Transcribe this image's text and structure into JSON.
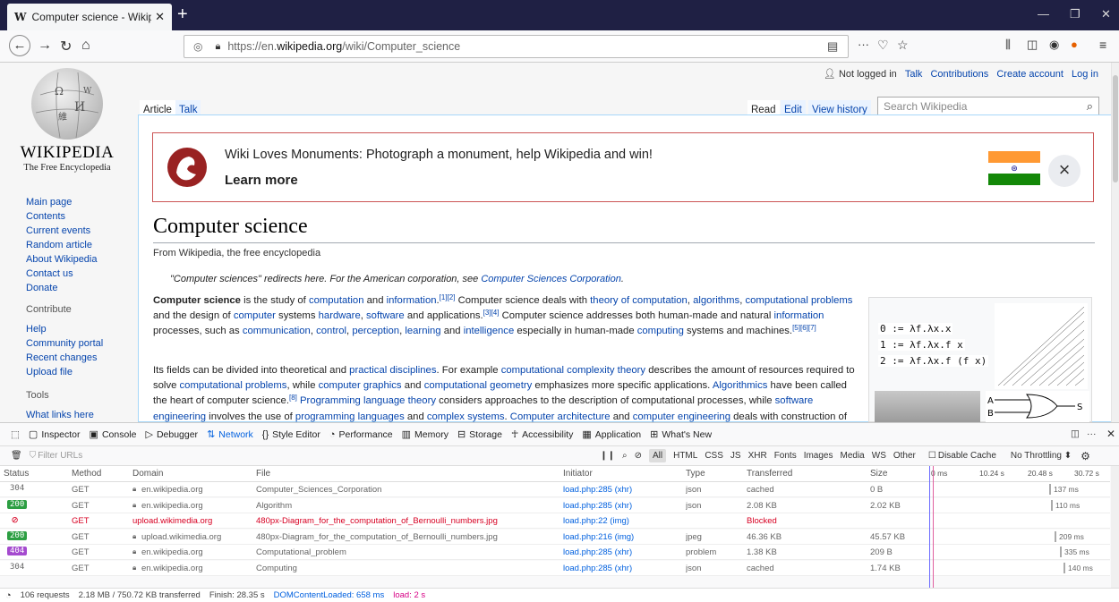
{
  "browser": {
    "tab_title": "Computer science - Wikipedia",
    "tab_favicon": "W",
    "url_prefix": "https://en.",
    "url_domain": "wikipedia.org",
    "url_path": "/wiki/Computer_science"
  },
  "wiki": {
    "wordmark": "WIKIPEDIA",
    "tagline": "The Free Encyclopedia",
    "personal": {
      "status": "Not logged in",
      "talk": "Talk",
      "contributions": "Contributions",
      "create": "Create account",
      "login": "Log in"
    },
    "tabs": {
      "article": "Article",
      "talk": "Talk",
      "read": "Read",
      "edit": "Edit",
      "history": "View history"
    },
    "search_placeholder": "Search Wikipedia",
    "nav": [
      "Main page",
      "Contents",
      "Current events",
      "Random article",
      "About Wikipedia",
      "Contact us",
      "Donate"
    ],
    "contribute_head": "Contribute",
    "contribute": [
      "Help",
      "Community portal",
      "Recent changes",
      "Upload file"
    ],
    "tools_head": "Tools",
    "tools": [
      "What links here"
    ],
    "banner": {
      "text": "Wiki Loves Monuments: Photograph a monument, help Wikipedia and win!",
      "learn": "Learn more"
    },
    "title": "Computer science",
    "subtitle": "From Wikipedia, the free encyclopedia",
    "hatnote": {
      "pre": "\"Computer sciences\" redirects here. For the American corporation, see ",
      "link": "Computer Sciences Corporation",
      "post": "."
    },
    "infobox": {
      "l0": "0 := λf.λx.x",
      "l1": "1 := λf.λx.f x",
      "l2": "2 := λf.λx.f (f x)",
      "gate_a": "A",
      "gate_b": "B",
      "gate_s": "S"
    }
  },
  "devtools": {
    "tools": [
      "Inspector",
      "Console",
      "Debugger",
      "Network",
      "Style Editor",
      "Performance",
      "Memory",
      "Storage",
      "Accessibility",
      "Application",
      "What's New"
    ],
    "filter_placeholder": "Filter URLs",
    "types": [
      "All",
      "HTML",
      "CSS",
      "JS",
      "XHR",
      "Fonts",
      "Images",
      "Media",
      "WS",
      "Other"
    ],
    "disable_cache": "Disable Cache",
    "throttling": "No Throttling ⬍",
    "columns": {
      "status": "Status",
      "method": "Method",
      "domain": "Domain",
      "file": "File",
      "initiator": "Initiator",
      "type": "Type",
      "transferred": "Transferred",
      "size": "Size"
    },
    "timeline": [
      "0 ms",
      "10.24 s",
      "20.48 s",
      "30.72 s"
    ],
    "rows": [
      {
        "status": "304",
        "method": "GET",
        "domain": "en.wikipedia.org",
        "file": "Computer_Sciences_Corporation",
        "initiator": "load.php:285 (xhr)",
        "type": "json",
        "transferred": "cached",
        "size": "0 B",
        "time": "137 ms"
      },
      {
        "status": "200",
        "method": "GET",
        "domain": "en.wikipedia.org",
        "file": "Algorithm",
        "initiator": "load.php:285 (xhr)",
        "type": "json",
        "transferred": "2.08 KB",
        "size": "2.02 KB",
        "time": "110 ms"
      },
      {
        "status": "⊘",
        "method": "GET",
        "domain": "upload.wikimedia.org",
        "file": "480px-Diagram_for_the_computation_of_Bernoulli_numbers.jpg",
        "initiator": "load.php:22 (img)",
        "type": "",
        "transferred": "Blocked",
        "size": "",
        "time": ""
      },
      {
        "status": "200",
        "method": "GET",
        "domain": "upload.wikimedia.org",
        "file": "480px-Diagram_for_the_computation_of_Bernoulli_numbers.jpg",
        "initiator": "load.php:216 (img)",
        "type": "jpeg",
        "transferred": "46.36 KB",
        "size": "45.57 KB",
        "time": "209 ms"
      },
      {
        "status": "404",
        "method": "GET",
        "domain": "en.wikipedia.org",
        "file": "Computational_problem",
        "initiator": "load.php:285 (xhr)",
        "type": "problem",
        "transferred": "1.38 KB",
        "size": "209 B",
        "time": "335 ms"
      },
      {
        "status": "304",
        "method": "GET",
        "domain": "en.wikipedia.org",
        "file": "Computing",
        "initiator": "load.php:285 (xhr)",
        "type": "json",
        "transferred": "cached",
        "size": "1.74 KB",
        "time": "140 ms"
      }
    ],
    "summary": {
      "requests": "106 requests",
      "transferred": "2.18 MB / 750.72 KB transferred",
      "finish": "Finish: 28.35 s",
      "dom": "DOMContentLoaded: 658 ms",
      "load": "load: 2 s"
    }
  }
}
